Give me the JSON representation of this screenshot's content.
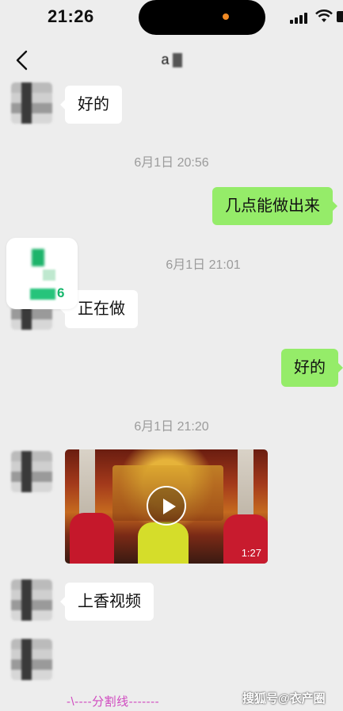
{
  "status_bar": {
    "time": "21:26"
  },
  "header": {
    "title_visible": "a",
    "back_icon": "chevron-left-icon"
  },
  "messages": [
    {
      "sender": "other",
      "text": "好的"
    },
    {
      "time": "6月1日 20:56"
    },
    {
      "sender": "me",
      "text": "几点能做出来"
    },
    {
      "time": "6月1日 21:01"
    },
    {
      "sender": "other",
      "text": "正在做"
    },
    {
      "sender": "me",
      "text": "好的"
    },
    {
      "time": "6月1日 21:20"
    },
    {
      "sender": "other",
      "type": "video",
      "duration": "1:27"
    },
    {
      "sender": "other",
      "text": "上香视频"
    }
  ],
  "overlay_badge": {
    "number": "6"
  },
  "footer": {
    "divider": "-\\----分割线-------",
    "watermark": "搜狐号@衣产圈"
  },
  "colors": {
    "background": "#ededed",
    "my_bubble": "#95ec69",
    "other_bubble": "#ffffff",
    "divider_text": "#d04ac0"
  }
}
